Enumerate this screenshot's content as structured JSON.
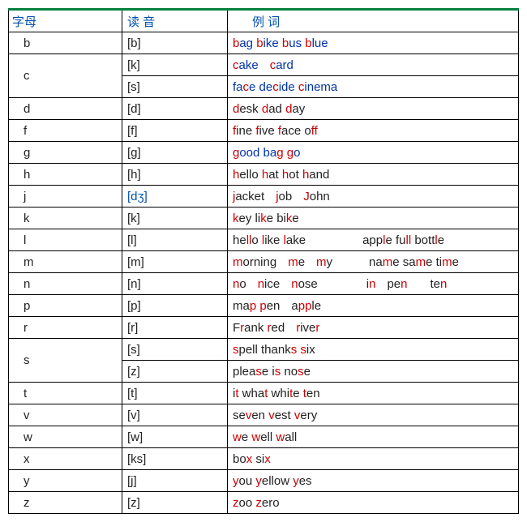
{
  "headers": {
    "letter": "字母",
    "pronunciation": "读 音",
    "examples": "例    词"
  },
  "chart_data": {
    "type": "table",
    "title": "",
    "columns": [
      "字母",
      "读 音",
      "例 词"
    ],
    "rows": [
      {
        "letter": "b",
        "pronunciation": "[b]",
        "examples": "bag bike bus blue"
      },
      {
        "letter": "c",
        "pronunciation": "[k]",
        "examples": "cake   card"
      },
      {
        "letter": "",
        "pronunciation": "[s]",
        "examples": "face decide cinema"
      },
      {
        "letter": "d",
        "pronunciation": "[d]",
        "examples": "desk dad day"
      },
      {
        "letter": "f",
        "pronunciation": "[f]",
        "examples": "fine five face off"
      },
      {
        "letter": "g",
        "pronunciation": "[g]",
        "examples": "good bag go"
      },
      {
        "letter": "h",
        "pronunciation": "[h]",
        "examples": "hello hat hot hand"
      },
      {
        "letter": "j",
        "pronunciation": "[dʒ]",
        "examples": "jacket   job   John"
      },
      {
        "letter": "k",
        "pronunciation": "[k]",
        "examples": "key like bike"
      },
      {
        "letter": "l",
        "pronunciation": "[l]",
        "examples": "hello like lake            apple full bottle"
      },
      {
        "letter": "m",
        "pronunciation": "[m]",
        "examples": "morning   me   my        name same time"
      },
      {
        "letter": "n",
        "pronunciation": "[n]",
        "examples": "no   nice   nose          in   pen    ten"
      },
      {
        "letter": "p",
        "pronunciation": "[p]",
        "examples": "map pen   apple"
      },
      {
        "letter": "r",
        "pronunciation": "[r]",
        "examples": "Frank red   river"
      },
      {
        "letter": "s",
        "pronunciation": "[s]",
        "examples": "spell thanks six"
      },
      {
        "letter": "",
        "pronunciation": "[z]",
        "examples": "please is nose"
      },
      {
        "letter": "t",
        "pronunciation": "[t]",
        "examples": "it what white ten"
      },
      {
        "letter": "v",
        "pronunciation": "[v]",
        "examples": "seven vest very"
      },
      {
        "letter": "w",
        "pronunciation": "[w]",
        "examples": "we well wall"
      },
      {
        "letter": "x",
        "pronunciation": "[ks]",
        "examples": "box six"
      },
      {
        "letter": "y",
        "pronunciation": "[j]",
        "examples": "you yellow yes"
      },
      {
        "letter": "z",
        "pronunciation": "[z]",
        "examples": "zoo zero"
      }
    ]
  },
  "rows": [
    {
      "letter": "b",
      "rowspan": 1,
      "pron": "[b]",
      "pronBlue": false,
      "html": "<span class='r'>b</span><span class='b'>ag </span><span class='r'>b</span><span class='b'>ike </span><span class='r'>b</span><span class='b'>us </span><span class='r'>b</span><span class='b'>lue</span>"
    },
    {
      "letter": "c",
      "rowspan": 2,
      "pron": "[k]",
      "pronBlue": false,
      "html": "<span class='r'>c</span><span class='b'>ake</span><span class='gap'></span><span class='r'>c</span><span class='b'>ard</span>"
    },
    {
      "letter": null,
      "rowspan": 0,
      "pron": "[s]",
      "pronBlue": false,
      "html": "<span class='b'>fa</span><span class='r'>c</span><span class='b'>e de</span><span class='r'>c</span><span class='b'>ide </span><span class='r'>c</span><span class='b'>inema</span>"
    },
    {
      "letter": "d",
      "rowspan": 1,
      "pron": "[d]",
      "pronBlue": false,
      "html": "<span class='r'>d</span><span class='k'>esk </span><span class='r'>d</span><span class='k'>ad </span><span class='r'>d</span><span class='k'>ay</span>"
    },
    {
      "letter": "f",
      "rowspan": 1,
      "pron": "[f]",
      "pronBlue": false,
      "html": "<span class='r'>f</span><span class='k'>ine </span><span class='r'>f</span><span class='k'>ive </span><span class='r'>f</span><span class='k'>ace o</span><span class='r'>ff</span>"
    },
    {
      "letter": "g",
      "rowspan": 1,
      "pron": "[g]",
      "pronBlue": false,
      "html": "<span class='r'>g</span><span class='b'>ood ba</span><span class='r'>g</span><span class='b'> </span><span class='r'>g</span><span class='b'>o</span>"
    },
    {
      "letter": "h",
      "rowspan": 1,
      "pron": "[h]",
      "pronBlue": false,
      "html": "<span class='r'>h</span><span class='k'>ello </span><span class='r'>h</span><span class='k'>at </span><span class='r'>h</span><span class='k'>ot </span><span class='r'>h</span><span class='k'>and</span>"
    },
    {
      "letter": "j",
      "rowspan": 1,
      "pron": "[dʒ]",
      "pronBlue": true,
      "html": "<span class='r'>j</span><span class='k'>acket</span><span class='gap'></span><span class='r'>j</span><span class='k'>ob</span><span class='gap'></span><span class='r'>J</span><span class='k'>ohn</span>"
    },
    {
      "letter": "k",
      "rowspan": 1,
      "pron": "[k]",
      "pronBlue": false,
      "html": "<span class='r'>k</span><span class='k'>ey li</span><span class='r'>k</span><span class='k'>e bi</span><span class='r'>k</span><span class='k'>e</span>"
    },
    {
      "letter": "l",
      "rowspan": 1,
      "pron": "[l]",
      "pronBlue": false,
      "html": "<span class='k'>he</span><span class='r'>ll</span><span class='k'>o </span><span class='r'>l</span><span class='k'>ike </span><span class='r'>l</span><span class='k'>ake</span><span class='gap2'></span><span class='k'>app</span><span class='r'>l</span><span class='k'>e fu</span><span class='r'>ll</span><span class='k'> bott</span><span class='r'>l</span><span class='k'>e</span>"
    },
    {
      "letter": "m",
      "rowspan": 1,
      "pron": "[m]",
      "pronBlue": false,
      "html": "<span class='r'>m</span><span class='k'>orning</span><span class='gap'></span><span class='r'>m</span><span class='k'>e</span><span class='gap'></span><span class='r'>m</span><span class='k'>y</span><span class='gap2b'></span><span class='k'>na</span><span class='r'>m</span><span class='k'>e sa</span><span class='r'>m</span><span class='k'>e ti</span><span class='r'>m</span><span class='k'>e</span>"
    },
    {
      "letter": "n",
      "rowspan": 1,
      "pron": "[n]",
      "pronBlue": false,
      "html": "<span class='r'>n</span><span class='k'>o</span><span class='gap'></span><span class='r'>n</span><span class='k'>ice</span><span class='gap'></span><span class='r'>n</span><span class='k'>ose</span><span class='gap2c'></span><span class='k'>i</span><span class='r'>n</span><span class='gap'></span><span class='k'>pe</span><span class='r'>n</span><span class='gap'></span><span class='gap'></span><span class='k'>te</span><span class='r'>n</span>"
    },
    {
      "letter": "p",
      "rowspan": 1,
      "pron": "[p]",
      "pronBlue": false,
      "html": "<span class='k'>ma</span><span class='r'>p</span><span class='k'> </span><span class='r'>p</span><span class='k'>en</span><span class='gap'></span><span class='k'>a</span><span class='r'>pp</span><span class='k'>le</span>"
    },
    {
      "letter": "r",
      "rowspan": 1,
      "pron": "[r]",
      "pronBlue": false,
      "html": "<span class='k'>F</span><span class='r'>r</span><span class='k'>ank </span><span class='r'>r</span><span class='k'>ed</span><span class='gap'></span><span class='r'>r</span><span class='k'>ive</span><span class='r'>r</span>"
    },
    {
      "letter": "s",
      "rowspan": 2,
      "pron": "[s]",
      "pronBlue": false,
      "html": "<span class='r'>s</span><span class='k'>pell thank</span><span class='r'>s</span><span class='k'> </span><span class='r'>s</span><span class='k'>ix</span>"
    },
    {
      "letter": null,
      "rowspan": 0,
      "pron": "[z]",
      "pronBlue": false,
      "html": "<span class='k'>plea</span><span class='r'>s</span><span class='k'>e i</span><span class='r'>s</span><span class='k'> no</span><span class='r'>s</span><span class='k'>e</span>"
    },
    {
      "letter": "t",
      "rowspan": 1,
      "pron": "[t]",
      "pronBlue": false,
      "html": "<span class='k'>i</span><span class='r'>t</span><span class='k'> wha</span><span class='r'>t</span><span class='k'> whi</span><span class='r'>t</span><span class='k'>e </span><span class='r'>t</span><span class='k'>en</span>"
    },
    {
      "letter": "v",
      "rowspan": 1,
      "pron": "[v]",
      "pronBlue": false,
      "html": "<span class='k'>se</span><span class='r'>v</span><span class='k'>en </span><span class='r'>v</span><span class='k'>est </span><span class='r'>v</span><span class='k'>ery</span>"
    },
    {
      "letter": "w",
      "rowspan": 1,
      "pron": "[w]",
      "pronBlue": false,
      "html": "<span class='r'>w</span><span class='k'>e </span><span class='r'>w</span><span class='k'>ell </span><span class='r'>w</span><span class='k'>all</span>"
    },
    {
      "letter": "x",
      "rowspan": 1,
      "pron": "[ks]",
      "pronBlue": false,
      "html": "<span class='k'>bo</span><span class='r'>x</span><span class='k'> si</span><span class='r'>x</span>"
    },
    {
      "letter": "y",
      "rowspan": 1,
      "pron": "[j]",
      "pronBlue": false,
      "html": "<span class='r'>y</span><span class='k'>ou </span><span class='r'>y</span><span class='k'>ellow </span><span class='r'>y</span><span class='k'>es</span>"
    },
    {
      "letter": "z",
      "rowspan": 1,
      "pron": "[z]",
      "pronBlue": false,
      "html": "<span class='r'>z</span><span class='k'>oo </span><span class='r'>z</span><span class='k'>ero</span>"
    }
  ]
}
